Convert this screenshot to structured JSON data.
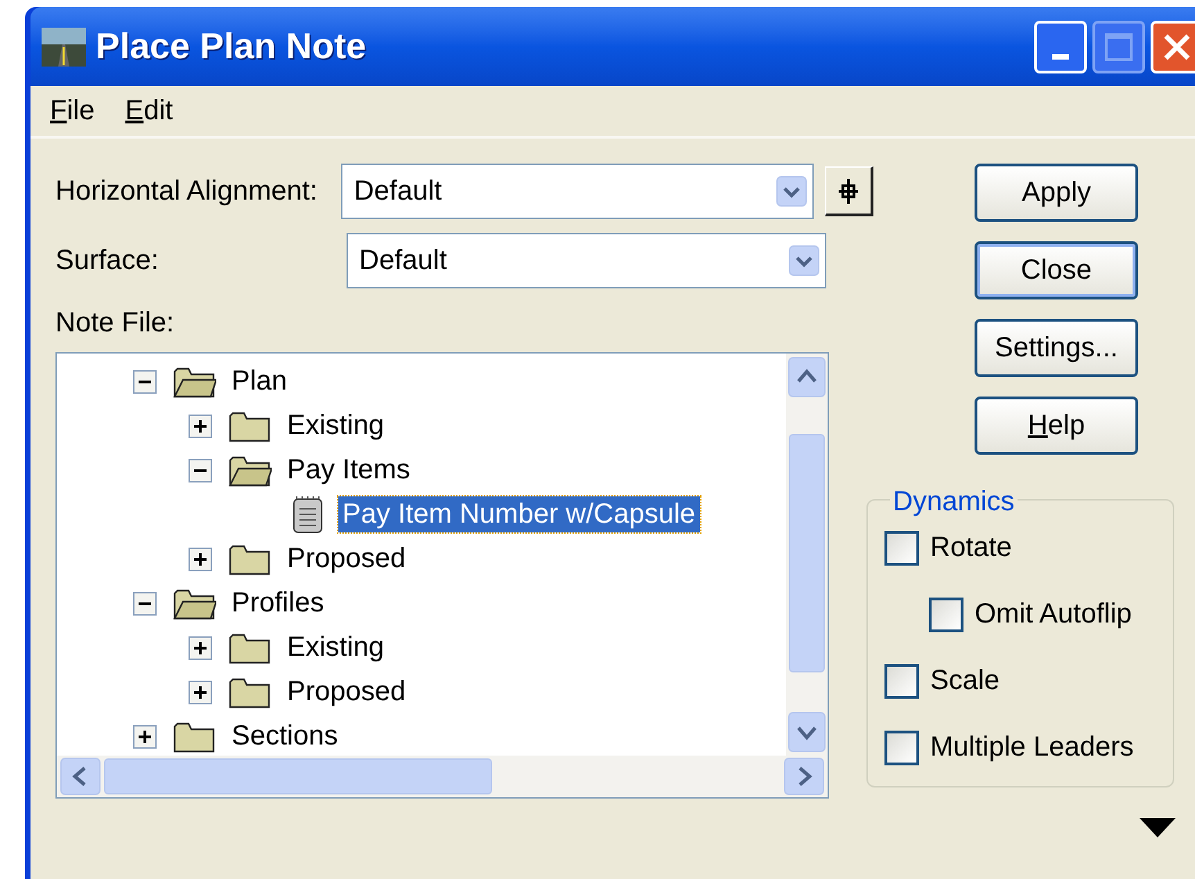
{
  "window": {
    "title": "Place Plan Note"
  },
  "menu": [
    {
      "label": "File",
      "underline_first": true
    },
    {
      "label": "Edit",
      "underline_first": true
    }
  ],
  "fields": [
    {
      "label": "Horizontal Alignment:",
      "value": "Default",
      "has_target_button": true
    },
    {
      "label": "Surface:",
      "value": "Default",
      "has_target_button": false
    }
  ],
  "note_file": {
    "label": "Note File:",
    "tree": [
      {
        "label": "Plan",
        "kind": "folder",
        "expanded": true,
        "selected": false,
        "children": [
          {
            "label": "Existing",
            "kind": "folder",
            "expanded": false,
            "selected": false
          },
          {
            "label": "Pay Items",
            "kind": "folder",
            "expanded": true,
            "selected": false,
            "children": [
              {
                "label": "Pay Item Number w/Capsule",
                "kind": "note",
                "selected": true
              }
            ]
          },
          {
            "label": "Proposed",
            "kind": "folder",
            "expanded": false,
            "selected": false
          }
        ]
      },
      {
        "label": "Profiles",
        "kind": "folder",
        "expanded": true,
        "selected": false,
        "children": [
          {
            "label": "Existing",
            "kind": "folder",
            "expanded": false,
            "selected": false
          },
          {
            "label": "Proposed",
            "kind": "folder",
            "expanded": false,
            "selected": false
          }
        ]
      },
      {
        "label": "Sections",
        "kind": "folder",
        "expanded": false,
        "selected": false
      }
    ]
  },
  "buttons": [
    {
      "label": "Apply",
      "default": false,
      "underline_first": false
    },
    {
      "label": "Close",
      "default": true,
      "underline_first": false
    },
    {
      "label": "Settings...",
      "default": false,
      "underline_first": false
    },
    {
      "label": "Help",
      "default": false,
      "underline_first": true
    }
  ],
  "dynamics": {
    "title": "Dynamics",
    "options": [
      {
        "label": "Rotate",
        "checked": false,
        "children": [
          {
            "label": "Omit Autoflip",
            "checked": false
          }
        ]
      },
      {
        "label": "Scale",
        "checked": false
      },
      {
        "label": "Multiple Leaders",
        "checked": false
      }
    ]
  }
}
